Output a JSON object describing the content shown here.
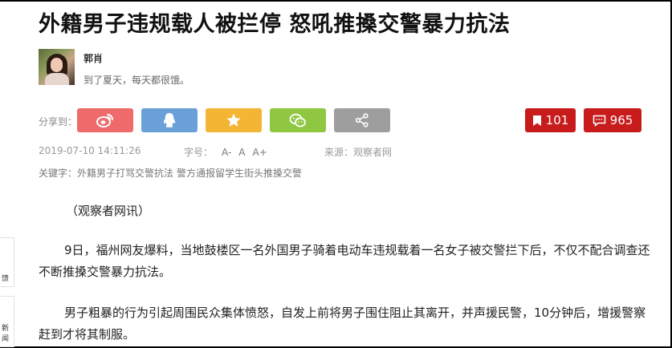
{
  "article": {
    "title": "外籍男子违规载人被拦停 怒吼推搡交警暴力抗法"
  },
  "author": {
    "name": "郭肖",
    "signature": "到了夏天，每天都很饿。"
  },
  "share": {
    "label": "分享到：",
    "buttons": [
      {
        "icon": "weibo-icon",
        "color": "#ef6b6b"
      },
      {
        "icon": "qq-icon",
        "color": "#6aa0d8"
      },
      {
        "icon": "star-icon",
        "color": "#f3b533"
      },
      {
        "icon": "wechat-icon",
        "color": "#8fc743"
      },
      {
        "icon": "share-icon",
        "color": "#9e9e9e"
      }
    ]
  },
  "counts": {
    "bookmark": "101",
    "comment": "965",
    "color": "#c81c1c"
  },
  "meta": {
    "time": "2019-07-10 14:11:26",
    "fontsize_label": "字号：",
    "fontsize_small": "A-",
    "fontsize_normal": "A",
    "fontsize_large": "A+",
    "source": "来源：观察者网"
  },
  "keywords": {
    "label": "关键字：",
    "items": [
      "外籍男子打骂交警抗法",
      "警方通报留学生街头推搡交警"
    ]
  },
  "body": {
    "p1": "（观察者网讯）",
    "p2": "9日，福州网友爆料，当地鼓楼区一名外国男子骑着电动车违规载着一名女子被交警拦下后，不仅不配合调查还不断推搡交警暴力抗法。",
    "p3": "男子粗暴的行为引起周围民众集体愤怒，自发上前将男子围住阻止其离开，并声援民警，10分钟后，增援警察赶到才将其制服。"
  },
  "side_tabs": {
    "tab1": "馈",
    "tab2": "新闻"
  }
}
